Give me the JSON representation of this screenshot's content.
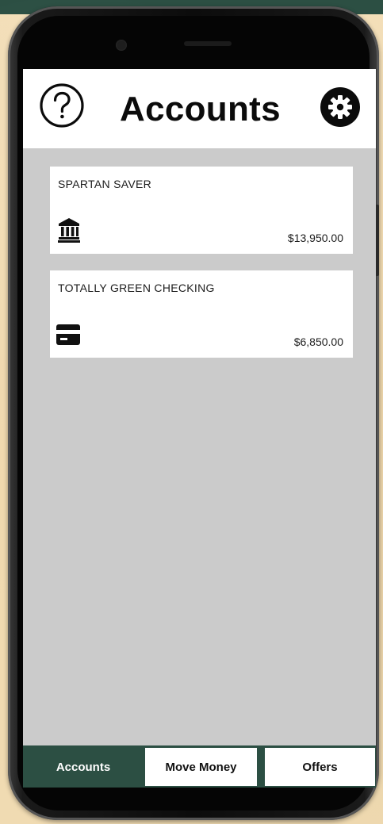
{
  "header": {
    "title": "Accounts",
    "help_icon": "help-circle-icon",
    "settings_icon": "gear-icon"
  },
  "accounts": [
    {
      "name": "SPARTAN SAVER",
      "balance": "$13,950.00",
      "icon": "bank-icon"
    },
    {
      "name": "TOTALLY GREEN CHECKING",
      "balance": "$6,850.00",
      "icon": "credit-card-icon"
    }
  ],
  "tabs": [
    {
      "label": "Accounts",
      "active": true
    },
    {
      "label": "Move Money",
      "active": false
    },
    {
      "label": "Offers",
      "active": false
    }
  ],
  "colors": {
    "brand_green": "#2c4f43",
    "screen_background": "#cbcbcb",
    "card_background": "#ffffff",
    "backdrop": "#f0dbb2"
  }
}
